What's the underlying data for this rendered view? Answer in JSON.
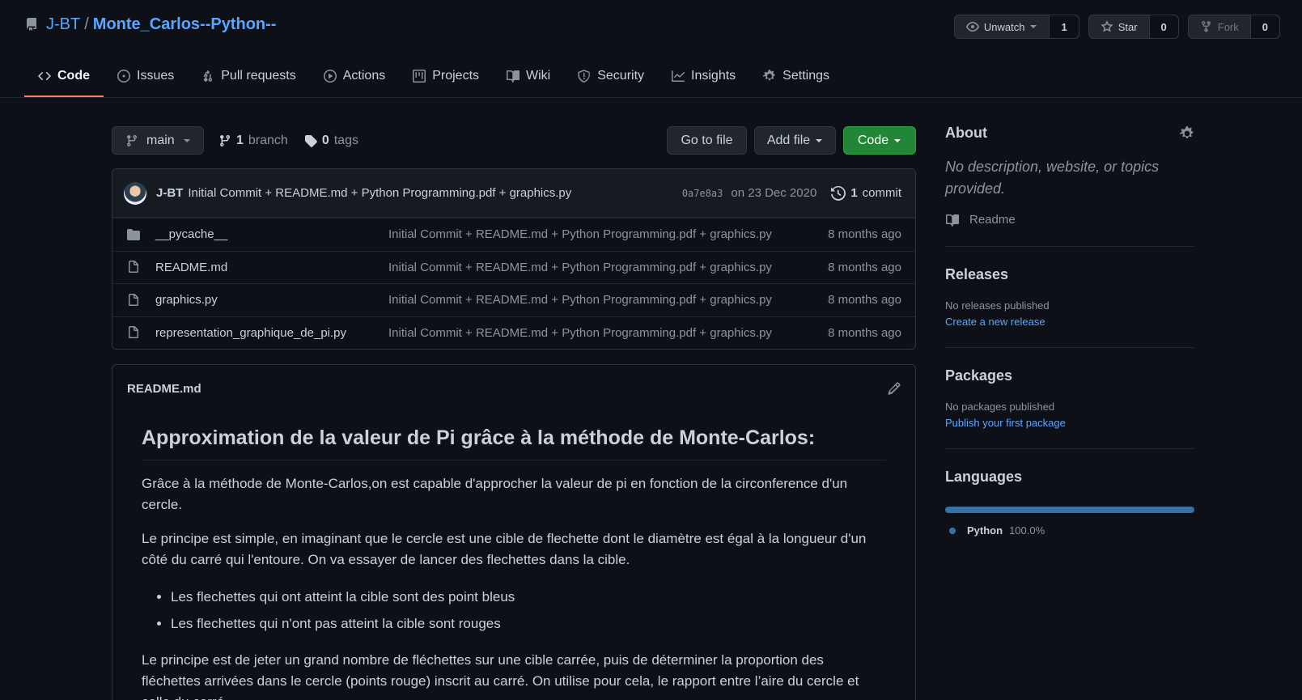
{
  "repo": {
    "owner": "J-BT",
    "separator": "/",
    "name": "Monte_Carlos--Python--"
  },
  "head_actions": {
    "watch": {
      "label": "Unwatch",
      "count": "1"
    },
    "star": {
      "label": "Star",
      "count": "0"
    },
    "fork": {
      "label": "Fork",
      "count": "0"
    }
  },
  "nav": {
    "items": [
      {
        "label": "Code"
      },
      {
        "label": "Issues"
      },
      {
        "label": "Pull requests"
      },
      {
        "label": "Actions"
      },
      {
        "label": "Projects"
      },
      {
        "label": "Wiki"
      },
      {
        "label": "Security"
      },
      {
        "label": "Insights"
      },
      {
        "label": "Settings"
      }
    ]
  },
  "branch": {
    "current": "main",
    "branch_count": "1",
    "branch_label": "branch",
    "tag_count": "0",
    "tag_label": "tags"
  },
  "buttons": {
    "go_to_file": "Go to file",
    "add_file": "Add file",
    "code": "Code"
  },
  "latest_commit": {
    "author": "J-BT",
    "message": "Initial Commit + README.md + Python Programming.pdf + graphics.py",
    "sha": "0a7e8a3",
    "date": "on 23 Dec 2020",
    "count": "1",
    "count_label": "commit"
  },
  "files": [
    {
      "name": "__pycache__",
      "type": "folder",
      "message": "Initial Commit + README.md + Python Programming.pdf + graphics.py",
      "age": "8 months ago"
    },
    {
      "name": "README.md",
      "type": "file",
      "message": "Initial Commit + README.md + Python Programming.pdf + graphics.py",
      "age": "8 months ago"
    },
    {
      "name": "graphics.py",
      "type": "file",
      "message": "Initial Commit + README.md + Python Programming.pdf + graphics.py",
      "age": "8 months ago"
    },
    {
      "name": "representation_graphique_de_pi.py",
      "type": "file",
      "message": "Initial Commit + README.md + Python Programming.pdf + graphics.py",
      "age": "8 months ago"
    }
  ],
  "readme": {
    "filename": "README.md",
    "title": "Approximation de la valeur de Pi grâce à la méthode de Monte-Carlos:",
    "p1": "Grâce à la méthode de Monte-Carlos,on est capable d'approcher la valeur de pi en fonction de la circonference d'un cercle.",
    "p2": "Le principe est simple, en imaginant que le cercle est une cible de flechette dont le diamètre est égal à la longueur d'un côté du carré qui l'entoure. On va essayer de lancer des flechettes dans la cible.",
    "bullets": [
      "Les flechettes qui ont atteint la cible sont des point bleus",
      "Les flechettes qui n'ont pas atteint la cible sont rouges"
    ],
    "p3": "Le principe est de jeter un grand nombre de fléchettes sur une cible carrée, puis de déterminer la proportion des fléchettes arrivées dans le cercle (points rouge) inscrit au carré. On utilise pour cela, le rapport entre l’aire du cercle et celle du carré."
  },
  "sidebar": {
    "about": {
      "title": "About",
      "description": "No description, website, or topics provided.",
      "readme_label": "Readme"
    },
    "releases": {
      "title": "Releases",
      "empty": "No releases published",
      "link": "Create a new release"
    },
    "packages": {
      "title": "Packages",
      "empty": "No packages published",
      "link": "Publish your first package"
    },
    "languages": {
      "title": "Languages",
      "name": "Python",
      "percent": "100.0%",
      "share": 1.0,
      "color": "#3572a5"
    }
  },
  "colors": {
    "accent": "#58a6ff",
    "nav_underline": "#f78166",
    "green": "#238636",
    "bg": "#0d1117"
  }
}
